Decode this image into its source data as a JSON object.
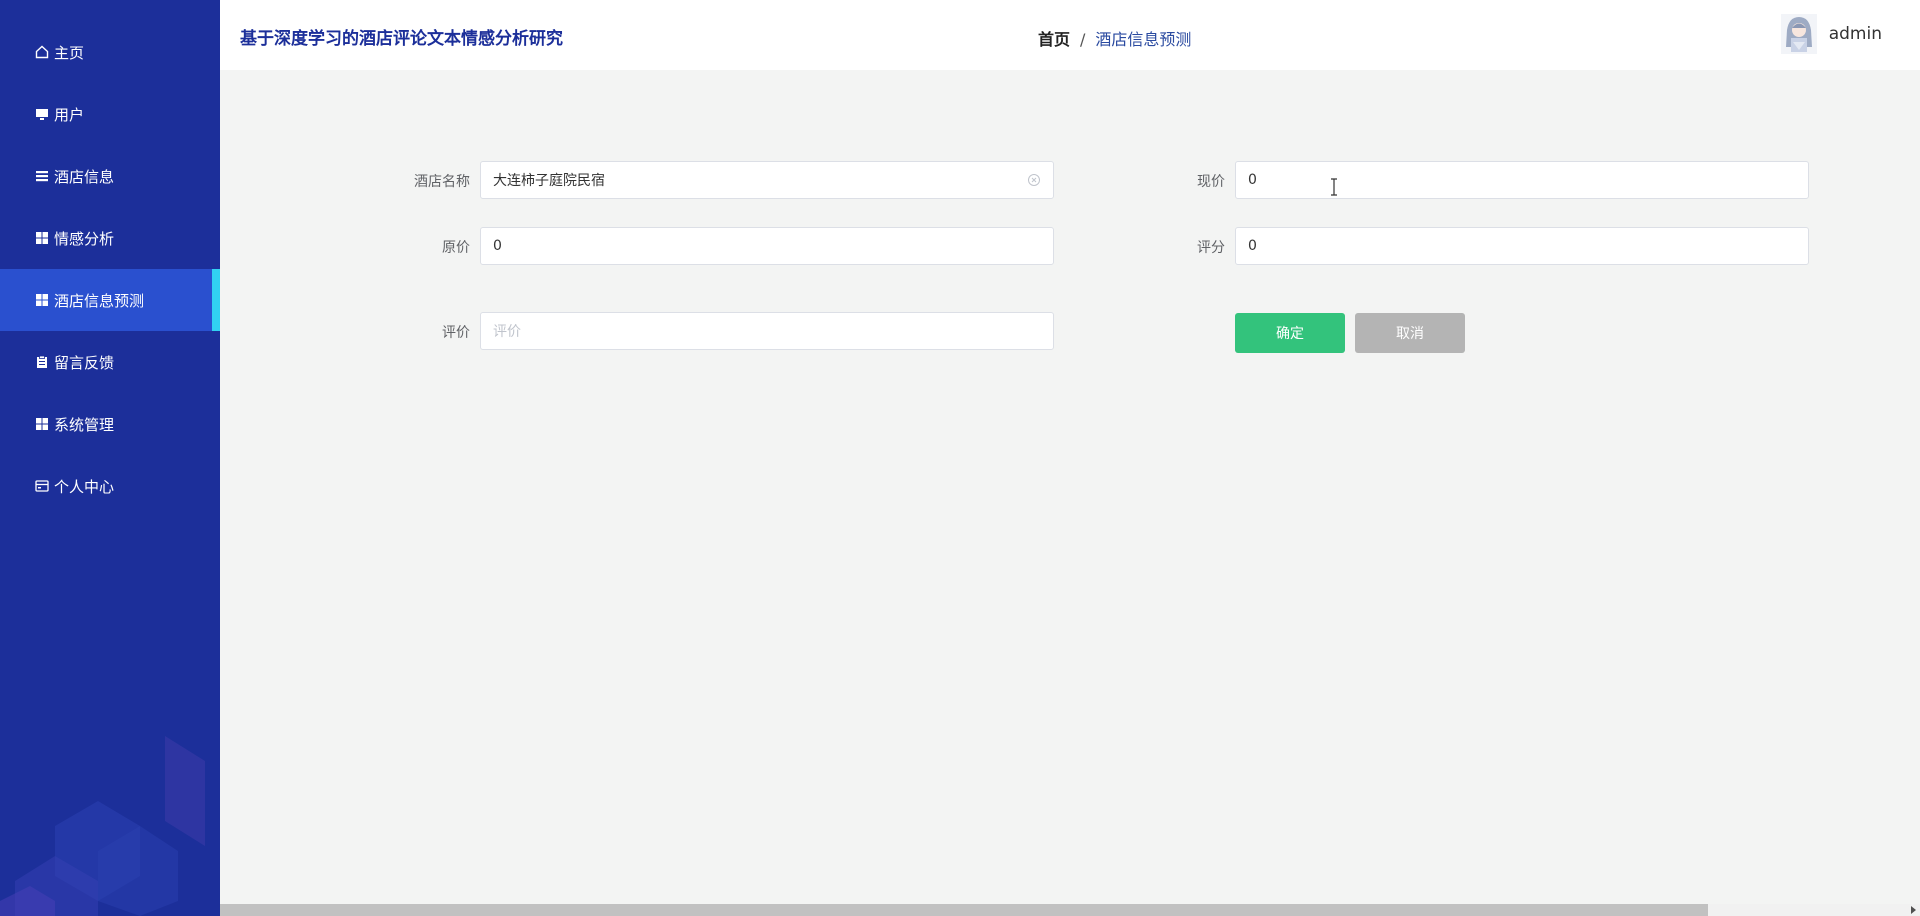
{
  "app": {
    "title": "基于深度学习的酒店评论文本情感分析研究"
  },
  "breadcrumb": {
    "home": "首页",
    "separator": "/",
    "current": "酒店信息预测"
  },
  "user": {
    "name": "admin",
    "avatar_icon": "avatar-image"
  },
  "sidebar": {
    "background": "#1c2f9a",
    "active_background": "#2a50cf",
    "active_indicator": "#31d2f2",
    "items": [
      {
        "label": "主页",
        "icon": "home-icon"
      },
      {
        "label": "用户",
        "icon": "monitor-icon"
      },
      {
        "label": "酒店信息",
        "icon": "list-icon"
      },
      {
        "label": "情感分析",
        "icon": "grid-icon"
      },
      {
        "label": "酒店信息预测",
        "icon": "grid-icon",
        "active": true
      },
      {
        "label": "留言反馈",
        "icon": "clipboard-icon"
      },
      {
        "label": "系统管理",
        "icon": "grid-icon"
      },
      {
        "label": "个人中心",
        "icon": "card-icon"
      }
    ]
  },
  "form": {
    "hotel_name": {
      "label": "酒店名称",
      "value": "大连柿子庭院民宿"
    },
    "current_price": {
      "label": "现价",
      "value": "0"
    },
    "original_price": {
      "label": "原价",
      "value": "0"
    },
    "score": {
      "label": "评分",
      "value": "0"
    },
    "review": {
      "label": "评价",
      "placeholder": "评价",
      "value": ""
    }
  },
  "buttons": {
    "confirm": "确定",
    "cancel": "取消"
  },
  "colors": {
    "confirm": "#33c37c",
    "cancel": "#b4b4b4",
    "title": "#1c2f9a"
  }
}
